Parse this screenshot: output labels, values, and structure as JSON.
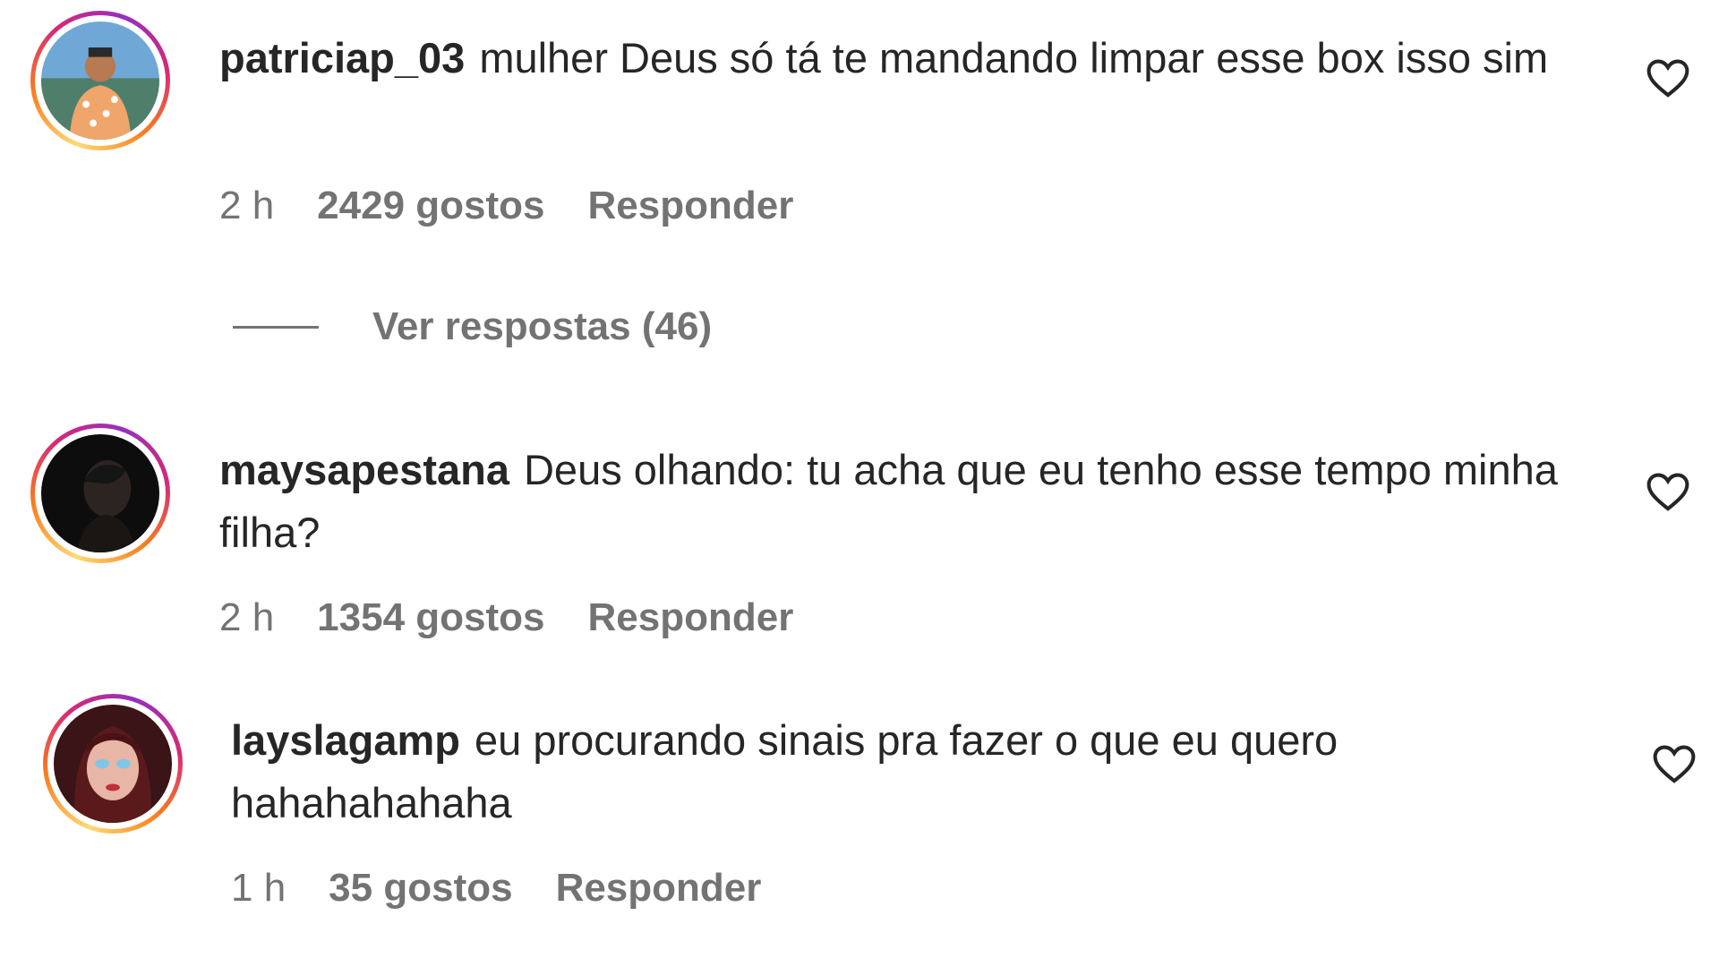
{
  "comments": [
    {
      "username": "patriciap_03",
      "text": "mulher Deus só tá te mandando limpar esse box isso sim",
      "time": "2 h",
      "likes": "2429 gostos",
      "reply_label": "Responder",
      "view_replies": "Ver respostas (46)",
      "avatar_icon": "user-photo-man-beach"
    },
    {
      "username": "maysapestana",
      "text": "Deus olhando: tu acha que eu tenho esse tempo minha filha?",
      "time": "2 h",
      "likes": "1354 gostos",
      "reply_label": "Responder",
      "avatar_icon": "user-photo-dark-silhouette"
    },
    {
      "username": "layslagamp",
      "text": "eu procurando sinais pra fazer o que eu quero hahahahahaha",
      "time": "1 h",
      "likes": "35 gostos",
      "reply_label": "Responder",
      "avatar_icon": "user-photo-woman-makeup"
    }
  ],
  "icons": {
    "like": "heart-outline-icon"
  },
  "colors": {
    "text": "#262626",
    "secondary": "#737373",
    "ring_gradient": [
      "#feda75",
      "#fa7e1e",
      "#d62976",
      "#962fbf"
    ]
  }
}
